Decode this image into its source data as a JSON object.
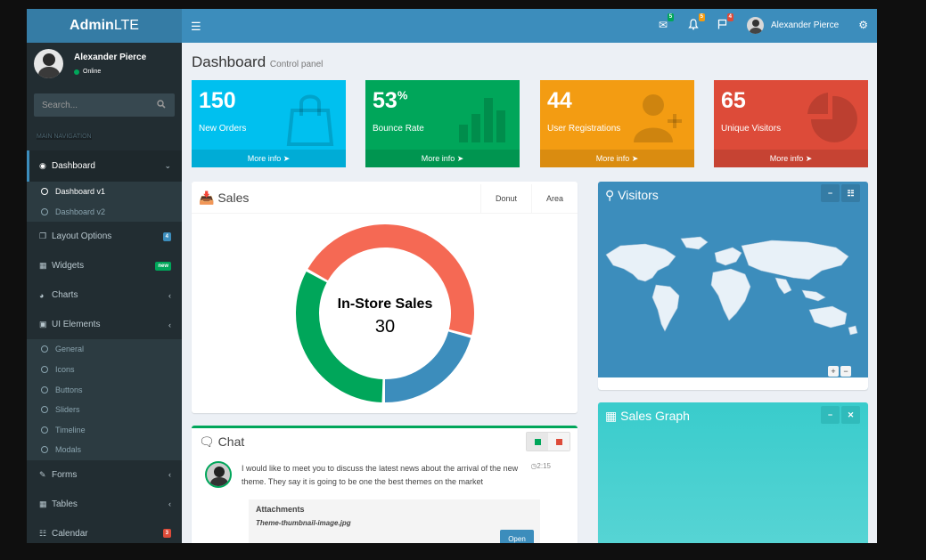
{
  "header": {
    "logo_bold": "Admin",
    "logo_rest": "LTE",
    "toggle_icon": "bars-icon",
    "mail_count": "5",
    "notif_count": "5",
    "flag_count": "4",
    "user_name": "Alexander Pierce",
    "gears_icon": "gears-icon",
    "colors": {
      "mail_badge": "#00a65a",
      "notif_badge": "#f39c12",
      "flag_badge": "#dd4b39"
    }
  },
  "sidebar": {
    "user_name": "Alexander Pierce",
    "status": "Online",
    "search_placeholder": "Search...",
    "nav_header": "MAIN NAVIGATION",
    "items": {
      "dashboard": "Dashboard",
      "dashboard_v1": "Dashboard v1",
      "dashboard_v2": "Dashboard v2",
      "layout": "Layout Options",
      "layout_badge": "4",
      "widgets": "Widgets",
      "widgets_badge": "new",
      "charts": "Charts",
      "ui": "UI Elements",
      "general": "General",
      "icons": "Icons",
      "buttons": "Buttons",
      "sliders": "Sliders",
      "timeline": "Timeline",
      "modals": "Modals",
      "forms": "Forms",
      "tables": "Tables",
      "calendar": "Calendar",
      "calendar_badge": "3"
    }
  },
  "page": {
    "title": "Dashboard",
    "subtitle": "Control panel"
  },
  "tiles": [
    {
      "value": "150",
      "sup": "",
      "label": "New Orders",
      "more": "More info",
      "color": "#00c0ef",
      "icon": "shopping-bag-icon"
    },
    {
      "value": "53",
      "sup": "%",
      "label": "Bounce Rate",
      "more": "More info",
      "color": "#00a65a",
      "icon": "bar-chart-icon"
    },
    {
      "value": "44",
      "sup": "",
      "label": "User Registrations",
      "more": "More info",
      "color": "#f39c12",
      "icon": "user-plus-icon"
    },
    {
      "value": "65",
      "sup": "",
      "label": "Unique Visitors",
      "more": "More info",
      "color": "#dd4b39",
      "icon": "pie-chart-icon"
    }
  ],
  "sales": {
    "title": "Sales",
    "tabs": [
      "Donut",
      "Area"
    ],
    "center_label": "In-Store Sales",
    "center_value": "30"
  },
  "chart_data": {
    "type": "pie",
    "labels": [
      "In-Store Sales"
    ],
    "values": [
      30
    ],
    "colors": [
      "#f56954",
      "#3c8dbc",
      "#00a65a"
    ]
  },
  "visitors": {
    "title": "Visitors",
    "zoom_in": "+",
    "zoom_out": "−",
    "color": "#3c8dbc"
  },
  "sales_graph": {
    "title": "Sales Graph",
    "color": "#39cccc"
  },
  "chat": {
    "title": "Chat",
    "time": "2:15",
    "message": "I would like to meet you to discuss the latest news about the arrival of the new theme. They say it is going to be one the best themes on the market",
    "attachments_title": "Attachments",
    "attachment_file": "Theme-thumbnail-image.jpg",
    "open_label": "Open"
  }
}
